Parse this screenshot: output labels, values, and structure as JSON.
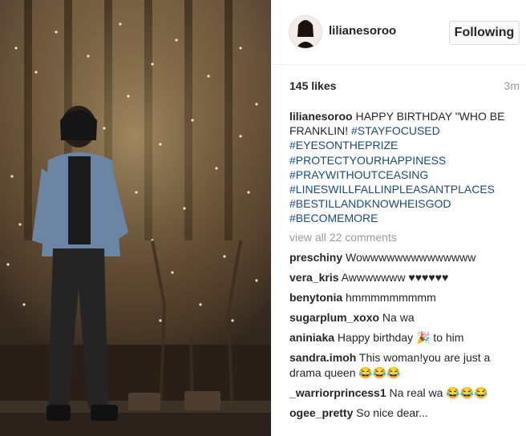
{
  "post": {
    "username": "lilianesoroo",
    "follow_label": "Following",
    "likes": "145 likes",
    "time_ago": "3m",
    "caption_user": "lilianesoroo",
    "caption_text": "HAPPY BIRTHDAY \"WHO BE FRANKLIN!",
    "hashtags": [
      "#STAYFOCUSED",
      "#EYESONTHEPRIZE",
      "#PROTECTYOURHAPPINESS",
      "#PRAYWITHOUTCEASING",
      "#LINESWILLFALLINPLEASANTPLACES",
      "#BESTILLANDKNOWHEISGOD",
      "#BECOMEMORE"
    ],
    "view_all": "view all 22 comments"
  },
  "comments": [
    {
      "user": "preschiny",
      "text": "Wowwwwwwwwwwwwww"
    },
    {
      "user": "vera_kris",
      "text": "Awwwwwww ♥♥♥♥♥♥"
    },
    {
      "user": "benytonia",
      "text": "hmmmmmmmmm"
    },
    {
      "user": "sugarplum_xoxo",
      "text": "Na wa"
    },
    {
      "user": "aniniaka",
      "text": "Happy birthday 🎉 to him"
    },
    {
      "user": "sandra.imoh",
      "text": "This woman!you are just a drama queen 😂😂😂"
    },
    {
      "user": "_warriorprincess1",
      "text": "Na real wa 😂😂😂"
    },
    {
      "user": "ogee_pretty",
      "text": "So nice dear..."
    }
  ],
  "colors": {
    "hashtag": "#1c4b7a",
    "muted": "#999999"
  },
  "icons": {
    "avatar": "profile-avatar"
  }
}
